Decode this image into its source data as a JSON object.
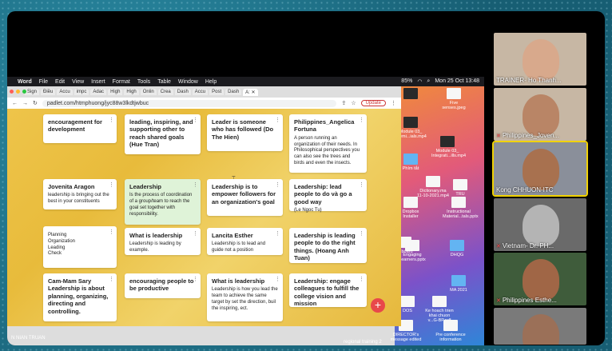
{
  "menubar": {
    "apple": "",
    "app": "Word",
    "items": [
      "File",
      "Edit",
      "View",
      "Insert",
      "Format",
      "Tools",
      "Table",
      "Window",
      "Help"
    ],
    "battery": "85%",
    "clock": "Mon 25 Oct 13:48"
  },
  "browser": {
    "tabs": [
      "Sign",
      "Điều",
      "Accu",
      "impc",
      "Adac",
      "High",
      "High",
      "Onlin",
      "Crea",
      "Dash",
      "Accu",
      "Post",
      "Dash",
      "A: ✕"
    ],
    "url": "padlet.com/htmphuong/jyc88w3lkdtjwbuc",
    "update_label": "Update"
  },
  "padlet": {
    "cards": [
      {
        "title": "encouragement for development",
        "desc": ""
      },
      {
        "title": "leading, inspiring, and supporting other to reach shared goals (Hue Tran)",
        "desc": ""
      },
      {
        "title": "Leader is someone who has followed (Do The Hien)",
        "desc": ""
      },
      {
        "title": "Philippines_Angelica Fortuna",
        "desc": "A person running an organization of their needs. In Philosophical perspectives you can also see the trees and birds and even the insects."
      },
      {
        "title": "Jovenita Aragon",
        "desc": "leadership is bringing out the best in your constituents"
      },
      {
        "title": "Leadership",
        "desc": "Is the process of coordination of a group/team to reach the goal set together with responsibility."
      },
      {
        "title": "Leadership is to empower followers for an organization's goal",
        "desc": ""
      },
      {
        "title": "Leadership: lead people to do và go a good way",
        "desc": "(Le Ngoc Tu)"
      },
      {
        "title": "",
        "desc": "Planning\nOrganization\nLeading\nCheck"
      },
      {
        "title": "What is leadership",
        "desc": "Leadership is leading by example."
      },
      {
        "title": "Lancita Esther",
        "desc": "Leadership is to lead and guide not a position"
      },
      {
        "title": "Leadership is leading people to do the right things. (Hoang Anh Tuan)",
        "desc": ""
      },
      {
        "title": "Cam-Mam Sary Leadership is about planning, organizing, directing and controlling.",
        "desc": ""
      },
      {
        "title": "encouraging people to be productive",
        "desc": ""
      },
      {
        "title": "What is leadership",
        "desc": "Leadership is how you lead the team to achieve the same target by set the direction, buil the inspiring, ect."
      },
      {
        "title": "Leadership: engage colleagues to fulfill the college vision and mission",
        "desc": ""
      }
    ],
    "add_label": "+"
  },
  "desktop": {
    "icons": [
      {
        "label": "",
        "type": "video"
      },
      {
        "label": "Five senses.jpeg",
        "type": "file"
      },
      {
        "label": "Module 03_ chemi...ials.mp4",
        "type": "video"
      },
      {
        "label": "Phím tắt",
        "type": "folder"
      },
      {
        "label": "Module 03_ Integrati...ills.mp4",
        "type": "video"
      },
      {
        "label": "Dropbox Installer",
        "type": "file"
      },
      {
        "label": "Instructional Material...tals.pptx",
        "type": "file"
      },
      {
        "label": "Engaging Learners.pptx",
        "type": "file"
      },
      {
        "label": "DHQG",
        "type": "folder"
      },
      {
        "label": "MA 2021",
        "type": "folder"
      },
      {
        "label": "Ke hoach trien khai chuon v...G-BP.pdf",
        "type": "file"
      },
      {
        "label": "DIRECTOR's message edited",
        "type": "file"
      },
      {
        "label": "Pre conference information",
        "type": "file"
      },
      {
        "label": "Dictionary.ma 11-10-2021.mp4",
        "type": "file"
      },
      {
        "label": "TRU",
        "type": "file"
      },
      {
        "label": "ity board",
        "type": "file"
      },
      {
        "label": "DOS",
        "type": "file"
      }
    ],
    "footer_left": "N NIAN TRUAN",
    "footer_center": "regional training 2"
  },
  "participants": [
    {
      "name": "TRAINER- Ho Thanh...",
      "skin": "#d8a98c",
      "bg": "#c7b7a4",
      "muted": false
    },
    {
      "name": "Philippines_Joven...",
      "skin": "#b98566",
      "bg": "#c7b7a4",
      "muted": true
    },
    {
      "name": "Kong CHHUON-ITC",
      "skin": "#a8714f",
      "bg": "#8a8f9a",
      "muted": false
    },
    {
      "name": "Vietnam- Dr. PH...",
      "skin": "#b4b4b4",
      "bg": "#6a6a6a",
      "muted": true
    },
    {
      "name": "Philippines Esthe...",
      "skin": "#a06646",
      "bg": "#3f5c3b",
      "muted": true
    },
    {
      "name": "",
      "skin": "#9b7058",
      "bg": "#7a7a7a",
      "muted": false
    }
  ]
}
